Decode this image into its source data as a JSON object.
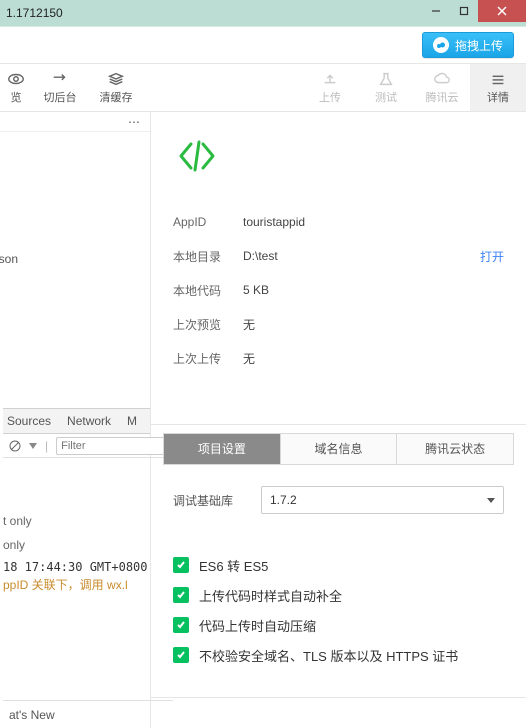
{
  "titlebar": {
    "version": "1.1712150"
  },
  "upload_button": {
    "label": "拖拽上传"
  },
  "toolbar": {
    "preview": "览",
    "background": "切后台",
    "clear_cache": "清缓存",
    "upload": "上传",
    "test": "测试",
    "cloud": "腾讯云",
    "details": "详情"
  },
  "file": {
    "name": "fig.json",
    "ellipsis": "⋯"
  },
  "detail": {
    "appid_label": "AppID",
    "appid_value": "touristappid",
    "local_dir_label": "本地目录",
    "local_dir_value": "D:\\test",
    "open": "打开",
    "local_code_label": "本地代码",
    "local_code_value": "5 KB",
    "last_preview_label": "上次预览",
    "last_preview_value": "无",
    "last_upload_label": "上次上传",
    "last_upload_value": "无"
  },
  "devtools": {
    "tabs": {
      "sources": "Sources",
      "network": "Network",
      "more": "M"
    },
    "filter_placeholder": "Filter",
    "lines": {
      "l1": "t only",
      "l2": "only",
      "l3": "18 17:44:30 GMT+0800",
      "l4_a": "ppID 关联下，调用",
      "l4_b": " wx.l"
    },
    "whatsnew": "at's New"
  },
  "tabs2": {
    "project_settings": "项目设置",
    "domain_info": "域名信息",
    "cloud_status": "腾讯云状态"
  },
  "settings": {
    "base_library_label": "调试基础库",
    "base_library_value": "1.7.2",
    "es6": "ES6 转 ES5",
    "style": "上传代码时样式自动补全",
    "compress": "代码上传时自动压缩",
    "no_verify": "不校验安全域名、TLS 版本以及 HTTPS 证书"
  }
}
